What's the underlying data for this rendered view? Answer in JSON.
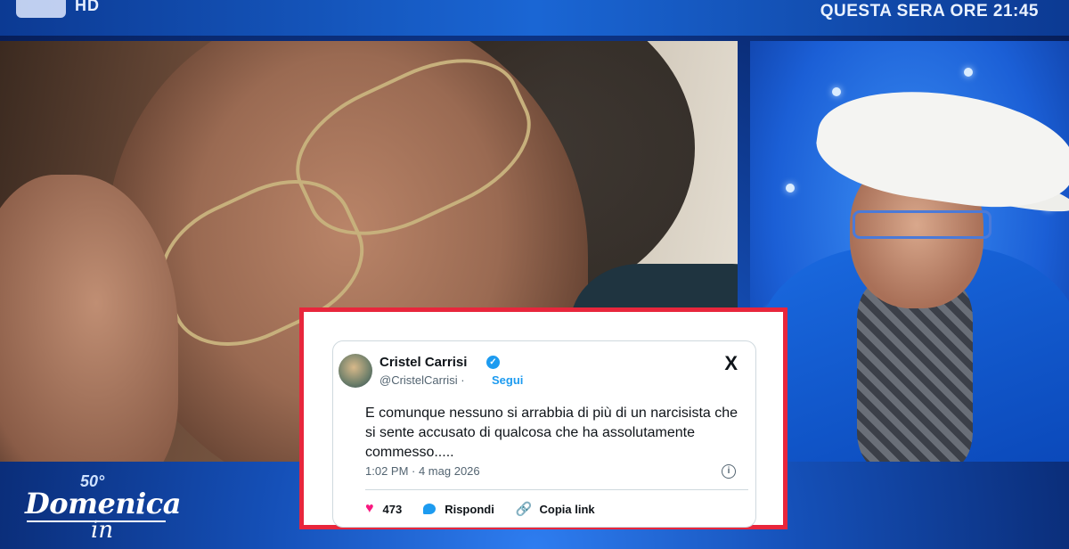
{
  "overlay": {
    "channel_badge": "HD",
    "promo": "QUESTA SERA ORE 21:45"
  },
  "show_logo": {
    "anniversary": "50°",
    "title": "Domenica",
    "subtitle": "in"
  },
  "tweet": {
    "author_name": "Cristel Carrisi",
    "handle": "@CristelCarrisi",
    "separator": "·",
    "follow_label": "Segui",
    "platform_logo": "X",
    "text": "E comunque nessuno si arrabbia di più di un narcisista che si sente accusato di qualcosa che ha assolutamente commesso.....",
    "timestamp": "1:02 PM · 4 mag 2026",
    "like_count": "473",
    "reply_label": "Rispondi",
    "copy_link_label": "Copia link",
    "icons": {
      "verified": "verified-badge-icon",
      "like": "heart-icon",
      "reply": "reply-bubble-icon",
      "copy": "link-icon",
      "info": "info-icon"
    }
  },
  "colors": {
    "frame_border": "#e8263c",
    "verified": "#1d9bf0",
    "like": "#f91880"
  }
}
